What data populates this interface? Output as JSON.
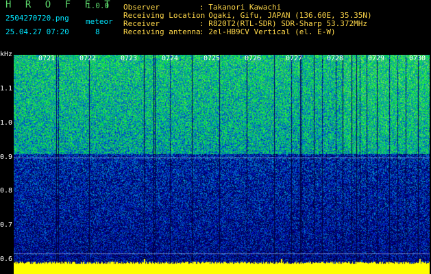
{
  "header": {
    "app_name": "H R O F F T",
    "version": "1.0.0",
    "filename": "2504270720.png",
    "category": "meteor",
    "datetime": "25.04.27 07:20",
    "count": "8",
    "fields": [
      {
        "label": "Observer",
        "value": ": Takanori Kawachi"
      },
      {
        "label": "Receiving Location",
        "value": ": Ogaki, Gifu, JAPAN (136.60E, 35.35N)"
      },
      {
        "label": "Receiver",
        "value": ": R820T2(RTL-SDR) SDR-Sharp 53.372MHz"
      },
      {
        "label": "Receiving antenna",
        "value": ": 2el-HB9CV Vertical (el. E-W)"
      }
    ]
  },
  "plot": {
    "y_unit": "kHz",
    "y_ticks": [
      "1.1",
      "1.0",
      "0.9",
      "0.8",
      "0.7",
      "0.6"
    ],
    "x_ticks": [
      "0721",
      "0722",
      "0723",
      "0724",
      "0725",
      "0726",
      "0727",
      "0728",
      "0729",
      "0730"
    ]
  }
}
